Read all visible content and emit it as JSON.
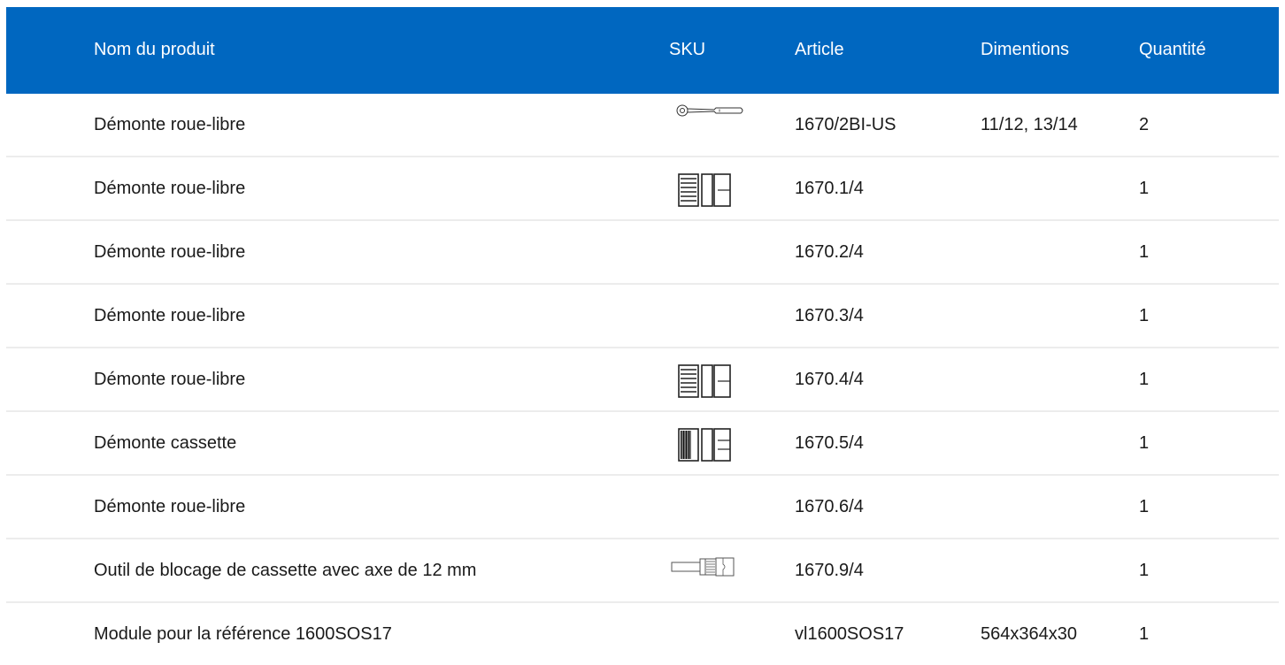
{
  "header": {
    "name": "Nom du produit",
    "sku": "SKU",
    "article": "Article",
    "dimensions": "Dimentions",
    "quantity": "Quantité"
  },
  "rows": [
    {
      "name": "Démonte roue-libre",
      "sku_icon": "ratchet-handle-icon",
      "article": "1670/2BI-US",
      "dimensions": "11/12, 13/14",
      "quantity": "2"
    },
    {
      "name": "Démonte roue-libre",
      "sku_icon": "freewheel-remover-icon",
      "article": "1670.1/4",
      "dimensions": "",
      "quantity": "1"
    },
    {
      "name": "Démonte roue-libre",
      "sku_icon": "",
      "article": "1670.2/4",
      "dimensions": "",
      "quantity": "1"
    },
    {
      "name": "Démonte roue-libre",
      "sku_icon": "",
      "article": "1670.3/4",
      "dimensions": "",
      "quantity": "1"
    },
    {
      "name": "Démonte roue-libre",
      "sku_icon": "freewheel-remover-icon",
      "article": "1670.4/4",
      "dimensions": "",
      "quantity": "1"
    },
    {
      "name": "Démonte cassette",
      "sku_icon": "cassette-remover-icon",
      "article": "1670.5/4",
      "dimensions": "",
      "quantity": "1"
    },
    {
      "name": "Démonte roue-libre",
      "sku_icon": "",
      "article": "1670.6/4",
      "dimensions": "",
      "quantity": "1"
    },
    {
      "name": "Outil de blocage de cassette avec axe de 12 mm",
      "sku_icon": "cassette-lockring-tool-icon",
      "article": "1670.9/4",
      "dimensions": "",
      "quantity": "1"
    },
    {
      "name": "Module pour la référence 1600SOS17",
      "sku_icon": "",
      "article": "vl1600SOS17",
      "dimensions": "564x364x30",
      "quantity": "1"
    }
  ],
  "colors": {
    "header_bg": "#0067c0",
    "header_text": "#ffffff",
    "divider": "#ececec"
  }
}
